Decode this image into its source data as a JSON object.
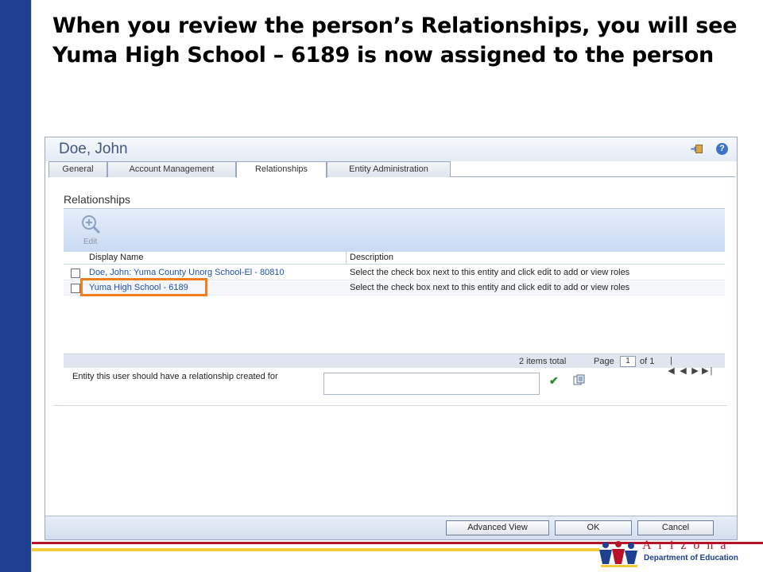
{
  "slide": {
    "title": "When you review the person’s Relationships, you will see Yuma High School – 6189 is now assigned to the person"
  },
  "window": {
    "title": "Doe, John",
    "tabs": [
      {
        "label": "General"
      },
      {
        "label": "Account Management"
      },
      {
        "label": "Relationships",
        "active": true
      },
      {
        "label": "Entity Administration"
      }
    ]
  },
  "relationships": {
    "section_title": "Relationships",
    "toolbar": {
      "edit_label": "Edit"
    },
    "columns": [
      "Display Name",
      "Description"
    ],
    "rows": [
      {
        "name": "Doe, John: Yuma County Unorg School-El - 80810",
        "description": "Select the check box next to this entity and click edit to add or view roles"
      },
      {
        "name": "Yuma High School - 6189",
        "description": "Select the check box next to this entity and click edit to add or view roles"
      }
    ],
    "pager": {
      "total": "2 items total",
      "page_label": "Page",
      "page_value": "1",
      "of_label": "of 1"
    },
    "entity_label": "Entity this user should have a relationship created for"
  },
  "footer": {
    "advanced_view": "Advanced View",
    "ok": "OK",
    "cancel": "Cancel"
  },
  "logo": {
    "name": "Arizona",
    "subtitle": "Department of Education"
  },
  "colors": {
    "accent_bar": "#1f3f8f",
    "highlight": "#f07d1e",
    "stripe_red": "#b8122b",
    "stripe_yellow": "#f2cb3a"
  }
}
